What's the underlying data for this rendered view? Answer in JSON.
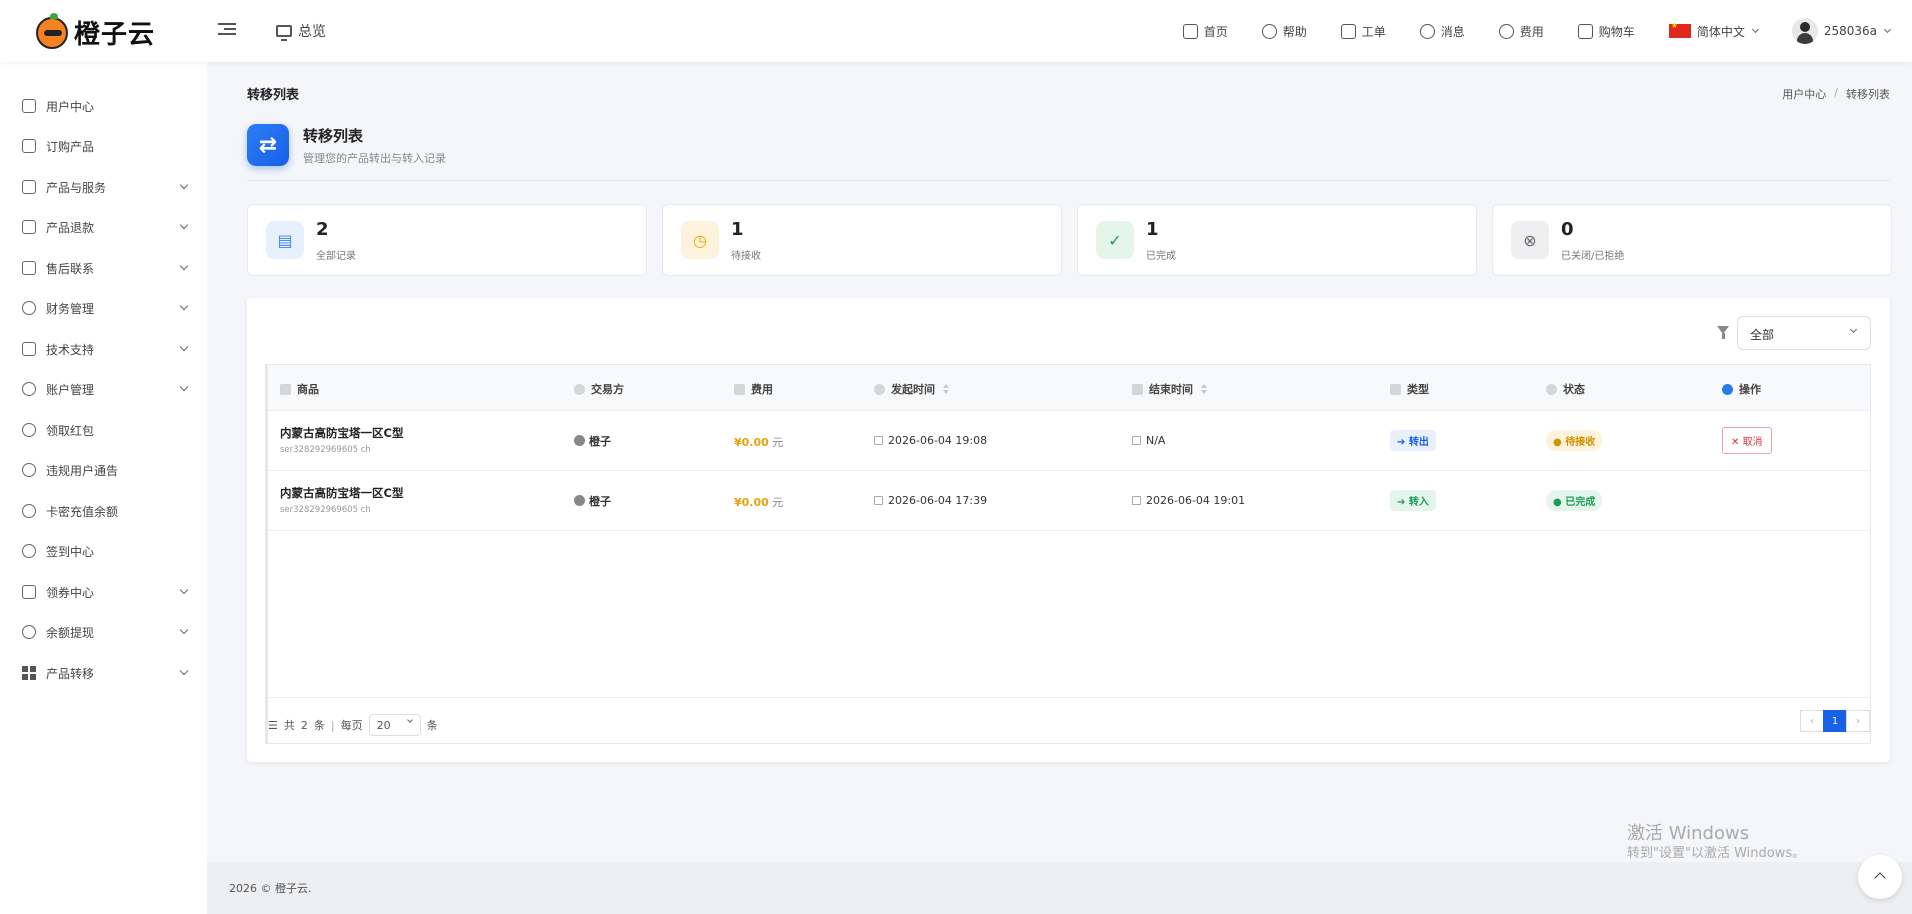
{
  "brand": {
    "name": "橙子云"
  },
  "header": {
    "overview": "总览",
    "nav": [
      {
        "label": "首页",
        "icon": "monitor-icon"
      },
      {
        "label": "帮助",
        "icon": "help-icon"
      },
      {
        "label": "工单",
        "icon": "ticket-icon"
      },
      {
        "label": "消息",
        "icon": "bell-icon"
      },
      {
        "label": "费用",
        "icon": "dollar-icon"
      },
      {
        "label": "购物车",
        "icon": "cart-icon"
      }
    ],
    "language": "简体中文",
    "username": "258036a"
  },
  "sidebar": {
    "items": [
      {
        "label": "用户中心",
        "icon": "home-icon",
        "expandable": false
      },
      {
        "label": "订购产品",
        "icon": "cart-icon",
        "expandable": false
      },
      {
        "label": "产品与服务",
        "icon": "briefcase-icon",
        "expandable": true
      },
      {
        "label": "产品退款",
        "icon": "sliders-icon",
        "expandable": true
      },
      {
        "label": "售后联系",
        "icon": "chat-icon",
        "expandable": true
      },
      {
        "label": "财务管理",
        "icon": "dollar-icon",
        "expandable": true
      },
      {
        "label": "技术支持",
        "icon": "document-icon",
        "expandable": true
      },
      {
        "label": "账户管理",
        "icon": "user-icon",
        "expandable": true
      },
      {
        "label": "领取红包",
        "icon": "clock-icon",
        "expandable": false
      },
      {
        "label": "违规用户通告",
        "icon": "bell-icon",
        "expandable": false
      },
      {
        "label": "卡密充值余额",
        "icon": "yen-icon",
        "expandable": false
      },
      {
        "label": "签到中心",
        "icon": "smile-icon",
        "expandable": false
      },
      {
        "label": "领券中心",
        "icon": "calendar-icon",
        "expandable": true
      },
      {
        "label": "余额提现",
        "icon": "dollar-icon",
        "expandable": true
      },
      {
        "label": "产品转移",
        "icon": "grid-icon",
        "expandable": true
      }
    ]
  },
  "page": {
    "title": "转移列表",
    "breadcrumb": [
      "用户中心",
      "转移列表"
    ],
    "heading": "转移列表",
    "subheading": "管理您的产品转出与转入记录"
  },
  "stats": [
    {
      "value": "2",
      "label": "全部记录",
      "icon": "document-icon",
      "color": "#3b82f6",
      "bg": "#e8f0fd"
    },
    {
      "value": "1",
      "label": "待接收",
      "icon": "clock-icon",
      "color": "#f0a500",
      "bg": "#fdf3dc"
    },
    {
      "value": "1",
      "label": "已完成",
      "icon": "check-circle-icon",
      "color": "#1e9a57",
      "bg": "#e4f6ec"
    },
    {
      "value": "0",
      "label": "已关闭/已拒绝",
      "icon": "x-circle-icon",
      "color": "#666666",
      "bg": "#efeff1"
    }
  ],
  "filter": {
    "selected": "全部"
  },
  "table": {
    "columns": [
      "商品",
      "交易方",
      "费用",
      "发起时间",
      "结束时间",
      "类型",
      "状态",
      "操作"
    ],
    "rows": [
      {
        "product": "内蒙古高防宝塔一区C型",
        "product_id": "ser328292969605 ch",
        "counterparty": "橙子",
        "price": "¥0.00",
        "unit": "元",
        "start": "2026-06-04 19:08",
        "end": "N/A",
        "type": "转出",
        "status": "待接收",
        "action": "取消"
      },
      {
        "product": "内蒙古高防宝塔一区C型",
        "product_id": "ser328292969605 ch",
        "counterparty": "橙子",
        "price": "¥0.00",
        "unit": "元",
        "start": "2026-06-04 17:39",
        "end": "2026-06-04 19:01",
        "type": "转入",
        "status": "已完成",
        "action": ""
      }
    ]
  },
  "pagination": {
    "total_prefix": "共",
    "total": "2",
    "total_suffix": "条",
    "per_page_label": "每页",
    "per_page": "20",
    "per_page_suffix": "条",
    "prev": "‹",
    "current": "1",
    "next": "›"
  },
  "footer": {
    "text": "2026 © 橙子云."
  },
  "watermark": {
    "line1": "激活 Windows",
    "line2": "转到\"设置\"以激活 Windows。"
  }
}
